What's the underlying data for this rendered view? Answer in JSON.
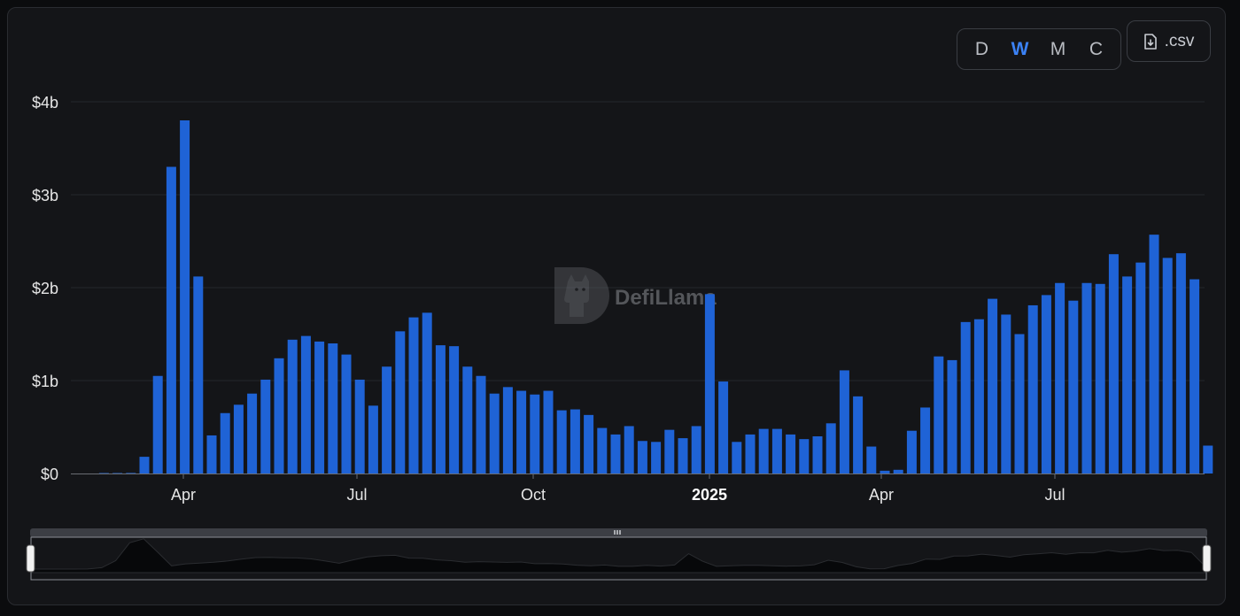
{
  "controls": {
    "groupings": [
      {
        "label": "D",
        "active": false
      },
      {
        "label": "W",
        "active": true
      },
      {
        "label": "M",
        "active": false
      },
      {
        "label": "C",
        "active": false
      }
    ],
    "csv_label": ".csv",
    "csv_icon": "file-download-icon"
  },
  "watermark": {
    "text": "DefiLlama",
    "icon": "llama-logo-icon"
  },
  "colors": {
    "bar": "#1f63d6",
    "active": "#3b82f6",
    "grid": "#24262b",
    "text": "#e6e6e6"
  },
  "chart_data": {
    "type": "bar",
    "title": "",
    "xlabel": "",
    "ylabel": "",
    "ylim": [
      0,
      4
    ],
    "y_unit": "$b",
    "y_ticks": [
      "$0",
      "$1b",
      "$2b",
      "$3b",
      "$4b"
    ],
    "x_tick_labels": [
      {
        "label": "Apr",
        "bold": false
      },
      {
        "label": "Jul",
        "bold": false
      },
      {
        "label": "Oct",
        "bold": false
      },
      {
        "label": "2025",
        "bold": true
      },
      {
        "label": "Apr",
        "bold": false
      },
      {
        "label": "Jul",
        "bold": false
      }
    ],
    "grid": true,
    "values": [
      0,
      0,
      0.005,
      0.005,
      0.006,
      0.18,
      1.05,
      3.3,
      3.8,
      2.12,
      0.41,
      0.65,
      0.74,
      0.86,
      1.01,
      1.24,
      1.44,
      1.48,
      1.42,
      1.4,
      1.28,
      1.01,
      0.73,
      1.15,
      1.53,
      1.68,
      1.73,
      1.38,
      1.37,
      1.15,
      1.05,
      0.86,
      0.93,
      0.89,
      0.85,
      0.89,
      0.68,
      0.69,
      0.63,
      0.49,
      0.42,
      0.51,
      0.35,
      0.34,
      0.47,
      0.38,
      0.51,
      1.93,
      0.99,
      0.34,
      0.42,
      0.48,
      0.48,
      0.42,
      0.37,
      0.4,
      0.54,
      1.11,
      0.83,
      0.29,
      0.03,
      0.04,
      0.46,
      0.71,
      1.26,
      1.22,
      1.63,
      1.66,
      1.88,
      1.71,
      1.5,
      1.81,
      1.92,
      2.05,
      1.86,
      2.05,
      2.04,
      2.36,
      2.12,
      2.27,
      2.57,
      2.32,
      2.37,
      2.09,
      0.3
    ]
  }
}
